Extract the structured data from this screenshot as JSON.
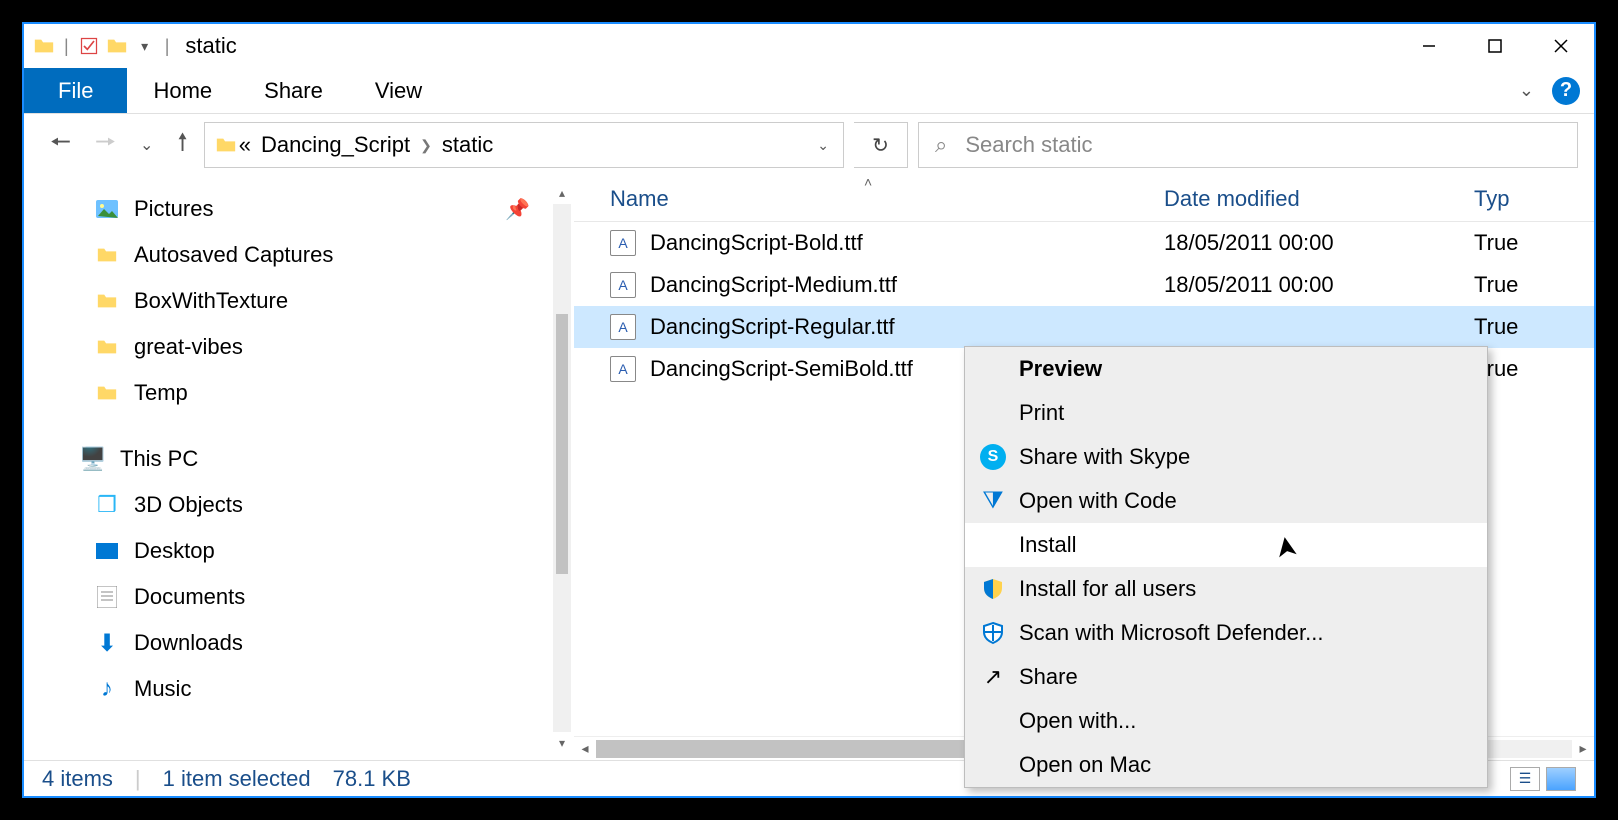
{
  "window": {
    "title": "static"
  },
  "ribbon": {
    "file": "File",
    "tabs": [
      "Home",
      "Share",
      "View"
    ]
  },
  "address": {
    "crumbs": [
      "Dancing_Script",
      "static"
    ],
    "prefix": "«"
  },
  "search": {
    "placeholder": "Search static"
  },
  "tree": {
    "top": [
      {
        "label": "Pictures",
        "icon": "picture"
      },
      {
        "label": "Autosaved Captures",
        "icon": "folder"
      },
      {
        "label": "BoxWithTexture",
        "icon": "folder"
      },
      {
        "label": "great-vibes",
        "icon": "folder"
      },
      {
        "label": "Temp",
        "icon": "folder"
      }
    ],
    "pc_label": "This PC",
    "pc": [
      {
        "label": "3D Objects",
        "icon": "3d"
      },
      {
        "label": "Desktop",
        "icon": "desktop"
      },
      {
        "label": "Documents",
        "icon": "documents"
      },
      {
        "label": "Downloads",
        "icon": "downloads"
      },
      {
        "label": "Music",
        "icon": "music"
      }
    ]
  },
  "columns": {
    "name": "Name",
    "date": "Date modified",
    "type": "Typ"
  },
  "files": [
    {
      "name": "DancingScript-Bold.ttf",
      "date": "18/05/2011 00:00",
      "type": "True",
      "selected": false
    },
    {
      "name": "DancingScript-Medium.ttf",
      "date": "18/05/2011 00:00",
      "type": "True",
      "selected": false
    },
    {
      "name": "DancingScript-Regular.ttf",
      "date": "",
      "type": "True",
      "selected": true
    },
    {
      "name": "DancingScript-SemiBold.ttf",
      "date": "",
      "type": "True",
      "selected": false
    }
  ],
  "context_menu": {
    "items": [
      {
        "label": "Preview",
        "bold": true,
        "icon": ""
      },
      {
        "label": "Print",
        "icon": ""
      },
      {
        "label": "Share with Skype",
        "icon": "skype"
      },
      {
        "label": "Open with Code",
        "icon": "vscode"
      },
      {
        "label": "Install",
        "icon": "",
        "hovered": true
      },
      {
        "label": "Install for all users",
        "icon": "shield"
      },
      {
        "label": "Scan with Microsoft Defender...",
        "icon": "defender"
      },
      {
        "label": "Share",
        "icon": "share"
      },
      {
        "label": "Open with...",
        "icon": ""
      },
      {
        "label": "Open on Mac",
        "icon": ""
      }
    ]
  },
  "status": {
    "count": "4 items",
    "selection": "1 item selected",
    "size": "78.1 KB"
  }
}
